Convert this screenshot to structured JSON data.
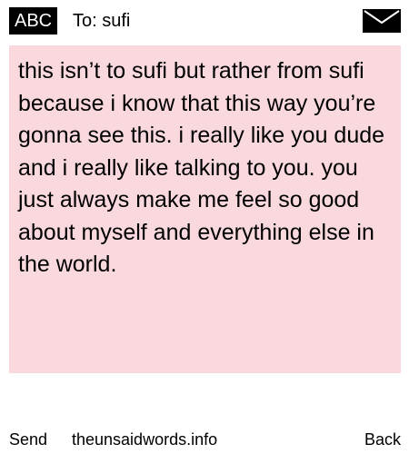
{
  "header": {
    "mode_badge": "ABC",
    "to_label": "To: sufi",
    "icon": "envelope-icon"
  },
  "message": {
    "text": "this isn’t to sufi but rather from sufi because i know that this way you’re gonna see this. i really like you dude and i really like talking to you. you just always make me feel so good about myself and everything else in the world."
  },
  "footer": {
    "send_label": "Send",
    "site_label": "theunsaidwords.info",
    "back_label": "Back"
  },
  "colors": {
    "message_background": "#fad9de",
    "badge_background": "#000000",
    "badge_text": "#ffffff"
  }
}
